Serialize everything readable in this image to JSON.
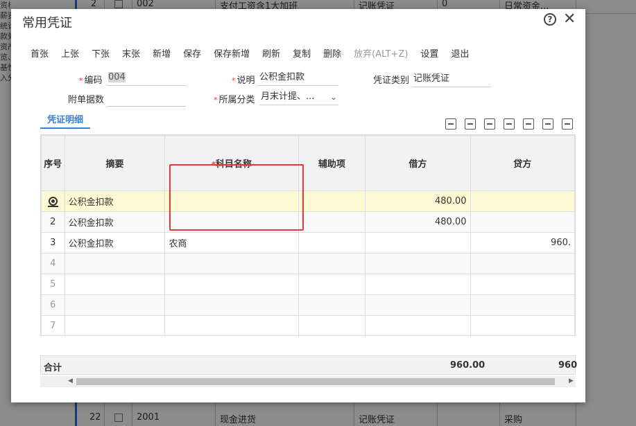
{
  "background": {
    "left_menu": [
      "资核算",
      "薪资",
      "统计",
      "款处",
      "资产核",
      "览、",
      "基性",
      "入分"
    ],
    "top_row": {
      "seq": "2",
      "code": "002",
      "desc": "支付工资含1大加班",
      "type": "记账凭证",
      "num": "0",
      "cat": "日常资金..."
    },
    "bottom_row": {
      "seq": "22",
      "code": "2001",
      "desc": "现金进货",
      "type": "记账凭证",
      "cat": "采购"
    }
  },
  "dialog": {
    "title": "常用凭证",
    "help_glyph": "?",
    "close_glyph": "✕"
  },
  "toolbar": [
    "首张",
    "上张",
    "下张",
    "末张",
    "新增",
    "保存",
    "保存新增",
    "刷新",
    "复制",
    "删除",
    "放弃(ALT+Z)",
    "设置",
    "退出"
  ],
  "form": {
    "code_label": "编码",
    "code_value": "004",
    "desc_label": "说明",
    "desc_value": "公积金扣款",
    "type_label": "凭证类别",
    "type_value": "记账凭证",
    "attach_label": "附单据数",
    "attach_value": "",
    "category_label": "所属分类",
    "category_value": "月末计提、..."
  },
  "tab_label": "凭证明细",
  "grid": {
    "headers": [
      "序号",
      "摘要",
      "科目名称",
      "辅助项",
      "借方",
      "贷方"
    ],
    "rows": [
      {
        "seq": "",
        "summary": "公积金扣款",
        "account": "",
        "aux": "",
        "debit": "480.00",
        "credit": ""
      },
      {
        "seq": "2",
        "summary": "公积金扣款",
        "account": "",
        "aux": "",
        "debit": "480.00",
        "credit": ""
      },
      {
        "seq": "3",
        "summary": "公积金扣款",
        "account": "农商",
        "aux": "",
        "debit": "",
        "credit": "960."
      },
      {
        "seq": "4",
        "summary": "",
        "account": "",
        "aux": "",
        "debit": "",
        "credit": ""
      },
      {
        "seq": "5",
        "summary": "",
        "account": "",
        "aux": "",
        "debit": "",
        "credit": ""
      },
      {
        "seq": "6",
        "summary": "",
        "account": "",
        "aux": "",
        "debit": "",
        "credit": ""
      },
      {
        "seq": "7",
        "summary": "",
        "account": "",
        "aux": "",
        "debit": "",
        "credit": ""
      }
    ]
  },
  "total": {
    "label": "合计",
    "debit": "960.00",
    "credit": "960"
  },
  "colors": {
    "accent": "#3a82d6",
    "required": "#e53935",
    "active_row": "#fff9d6",
    "highlight_box": "#e53935"
  }
}
